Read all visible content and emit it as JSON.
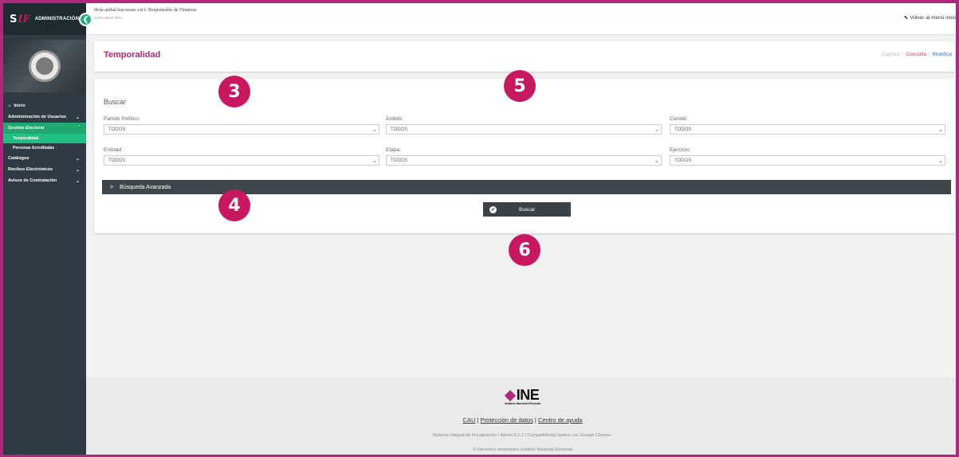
{
  "sidebar": {
    "brand": "ADMINISTRACIÓN",
    "logo_s": "S",
    "logo_f": "IF",
    "toggle_icon": "chevron-left-icon",
    "toggle_glyph": "❮",
    "items": [
      {
        "label": "Inicio"
      },
      {
        "label": "Administración de Usuarios"
      },
      {
        "label": "Gestión Electoral"
      },
      {
        "label": "Temporalidad"
      },
      {
        "label": "Personas Acreditadas"
      },
      {
        "label": "Catálogos"
      },
      {
        "label": "Recibos Electrónicos"
      },
      {
        "label": "Avisos de Contratación"
      }
    ],
    "accent": "#20a870"
  },
  "topbar": {
    "greeting": "Hola anibal.barcenasc.ext1/ Responsable de Finanzas",
    "sub": "SAPS-9924-XP0+",
    "back_menu": "Volver al menú inicio"
  },
  "page": {
    "title": "Temporalidad",
    "modes": {
      "captura": "Captura",
      "consulta": "Consulta",
      "modifica": "Modifica",
      "sep": "|"
    }
  },
  "search": {
    "heading": "Buscar",
    "fields": [
      {
        "label": "Partido Político:",
        "value": "TODOS"
      },
      {
        "label": "Ámbito:",
        "value": "TODOS"
      },
      {
        "label": "Comité:",
        "value": "TODOS"
      },
      {
        "label": "Entidad:",
        "value": "TODOS"
      },
      {
        "label": "Etapa:",
        "value": "TODOS"
      },
      {
        "label": "Ejercicio:",
        "value": "TODOS"
      }
    ],
    "advanced": "Búsqueda Avanzada",
    "advanced_chevron": ">",
    "button": "Buscar",
    "button_check": "✔",
    "dropdown_glyph": "⌄"
  },
  "badges": [
    "3",
    "4",
    "5",
    "6"
  ],
  "footer": {
    "logo": "INE",
    "logo_sub": "Instituto Nacional Electoral",
    "link_cau": "CAU",
    "link_datos": "Protección de datos",
    "link_ayuda": "Centro de ayuda",
    "link_sep": "|",
    "system": "Sistema Integral de Fiscalización / Admin 6.1.2 | Compatibilidad óptima con Google Chrome.",
    "rights": "© Derechos reservados Instituto Nacional Electoral"
  },
  "colors": {
    "brand": "#b0287a",
    "badge": "#c8185f",
    "dark": "#3a4247",
    "consulta": "#d6336c",
    "modifica": "#2f6fcb"
  }
}
